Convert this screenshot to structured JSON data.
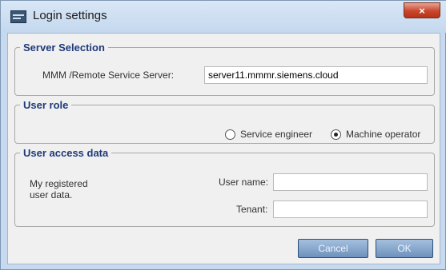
{
  "window": {
    "title": "Login settings",
    "close_glyph": "×"
  },
  "server_selection": {
    "legend": "Server Selection",
    "server_label": "MMM /Remote Service Server:",
    "server_value": "server11.mmmr.siemens.cloud"
  },
  "user_role": {
    "legend": "User role",
    "options": [
      {
        "label": "Service engineer",
        "selected": false
      },
      {
        "label": "Machine operator",
        "selected": true
      }
    ]
  },
  "user_access": {
    "legend": "User access data",
    "description_line1": "My registered",
    "description_line2": "user data.",
    "username_label": "User name:",
    "username_value": "",
    "tenant_label": "Tenant:",
    "tenant_value": ""
  },
  "buttons": {
    "cancel": "Cancel",
    "ok": "OK"
  },
  "colors": {
    "title_bar": "#c4d8ee",
    "close": "#c9452b",
    "legend_text": "#1f3a7a",
    "button": "#6d91bd"
  },
  "icons": {
    "app": "app-window-icon",
    "close": "close-icon"
  }
}
